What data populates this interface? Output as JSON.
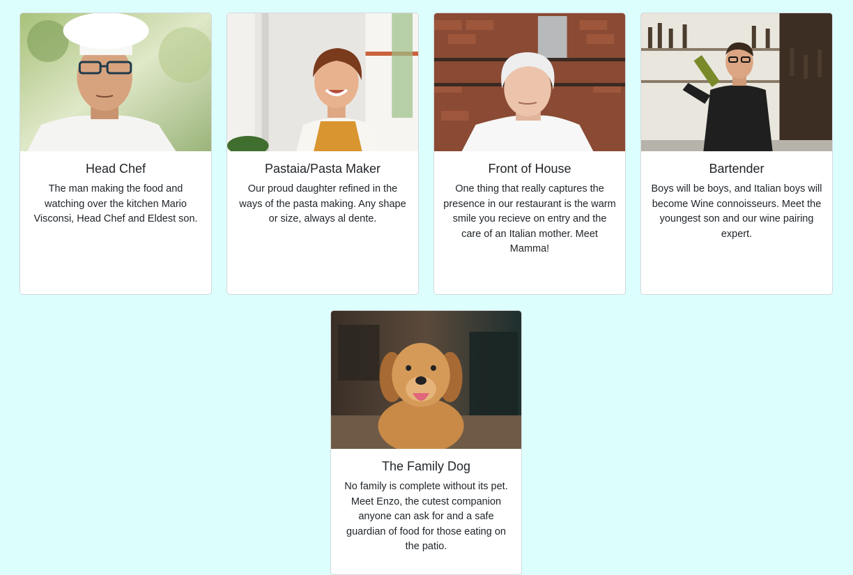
{
  "team": [
    {
      "title": "Head Chef",
      "text": "The man making the food and watching over the kitchen Mario Visconsi, Head Chef and Eldest son.",
      "photo": "chef-photo"
    },
    {
      "title": "Pastaia/Pasta Maker",
      "text": "Our proud daughter refined in the ways of the pasta making. Any shape or size, always al dente.",
      "photo": "pasta-maker-photo"
    },
    {
      "title": "Front of House",
      "text": "One thing that really captures the presence in our restaurant is the warm smile you recieve on entry and the care of an Italian mother. Meet Mamma!",
      "photo": "mamma-photo"
    },
    {
      "title": "Bartender",
      "text": "Boys will be boys, and Italian boys will become Wine connoisseurs. Meet the youngest son and our wine pairing expert.",
      "photo": "bartender-photo"
    },
    {
      "title": "The Family Dog",
      "text": "No family is complete without its pet. Meet Enzo, the cutest companion anyone can ask for and a safe guardian of food for those eating on the patio.",
      "photo": "dog-photo"
    }
  ],
  "colors": {
    "page_background": "#dcfffd",
    "card_background": "#ffffff",
    "card_border": "#d3d7dc",
    "text": "#212529"
  }
}
